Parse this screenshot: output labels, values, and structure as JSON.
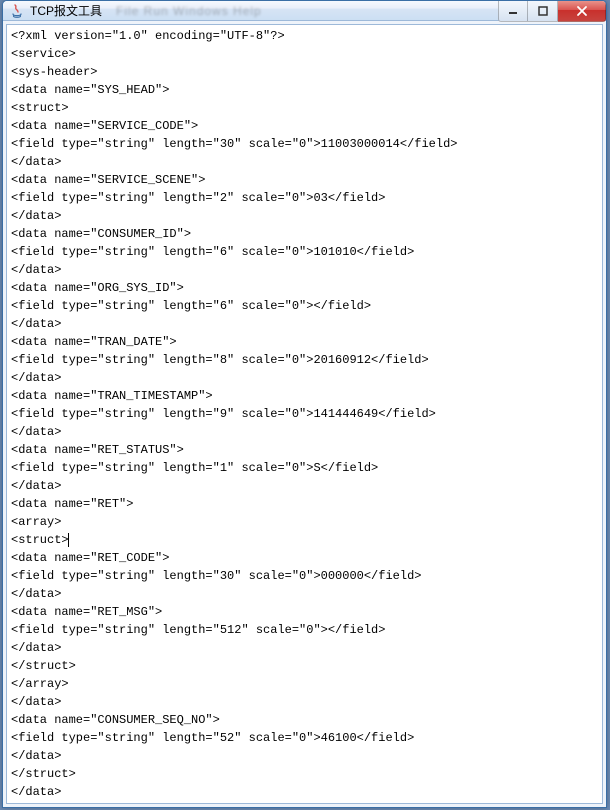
{
  "window": {
    "title": "TCP报文工具",
    "menu_blur": "File   Run   Windows   Help"
  },
  "controls": {
    "min_label": "minimize",
    "max_label": "maximize",
    "close_label": "close"
  },
  "lines": [
    "<?xml version=\"1.0\" encoding=\"UTF-8\"?>",
    "<service>",
    "<sys-header>",
    "<data name=\"SYS_HEAD\">",
    "<struct>",
    "<data name=\"SERVICE_CODE\">",
    "<field type=\"string\" length=\"30\" scale=\"0\">11003000014</field>",
    "</data>",
    "<data name=\"SERVICE_SCENE\">",
    "<field type=\"string\" length=\"2\" scale=\"0\">03</field>",
    "</data>",
    "<data name=\"CONSUMER_ID\">",
    "<field type=\"string\" length=\"6\" scale=\"0\">101010</field>",
    "</data>",
    "<data name=\"ORG_SYS_ID\">",
    "<field type=\"string\" length=\"6\" scale=\"0\"></field>",
    "</data>",
    "<data name=\"TRAN_DATE\">",
    "<field type=\"string\" length=\"8\" scale=\"0\">20160912</field>",
    "</data>",
    "<data name=\"TRAN_TIMESTAMP\">",
    "<field type=\"string\" length=\"9\" scale=\"0\">141444649</field>",
    "</data>",
    "<data name=\"RET_STATUS\">",
    "<field type=\"string\" length=\"1\" scale=\"0\">S</field>",
    "</data>",
    "<data name=\"RET\">",
    "<array>",
    "<struct>",
    "<data name=\"RET_CODE\">",
    "<field type=\"string\" length=\"30\" scale=\"0\">000000</field>",
    "</data>",
    "<data name=\"RET_MSG\">",
    "<field type=\"string\" length=\"512\" scale=\"0\"></field>",
    "</data>",
    "</struct>",
    "</array>",
    "</data>",
    "<data name=\"CONSUMER_SEQ_NO\">",
    "<field type=\"string\" length=\"52\" scale=\"0\">46100</field>",
    "</data>",
    "</struct>",
    "</data>"
  ],
  "caret_line_index": 28
}
